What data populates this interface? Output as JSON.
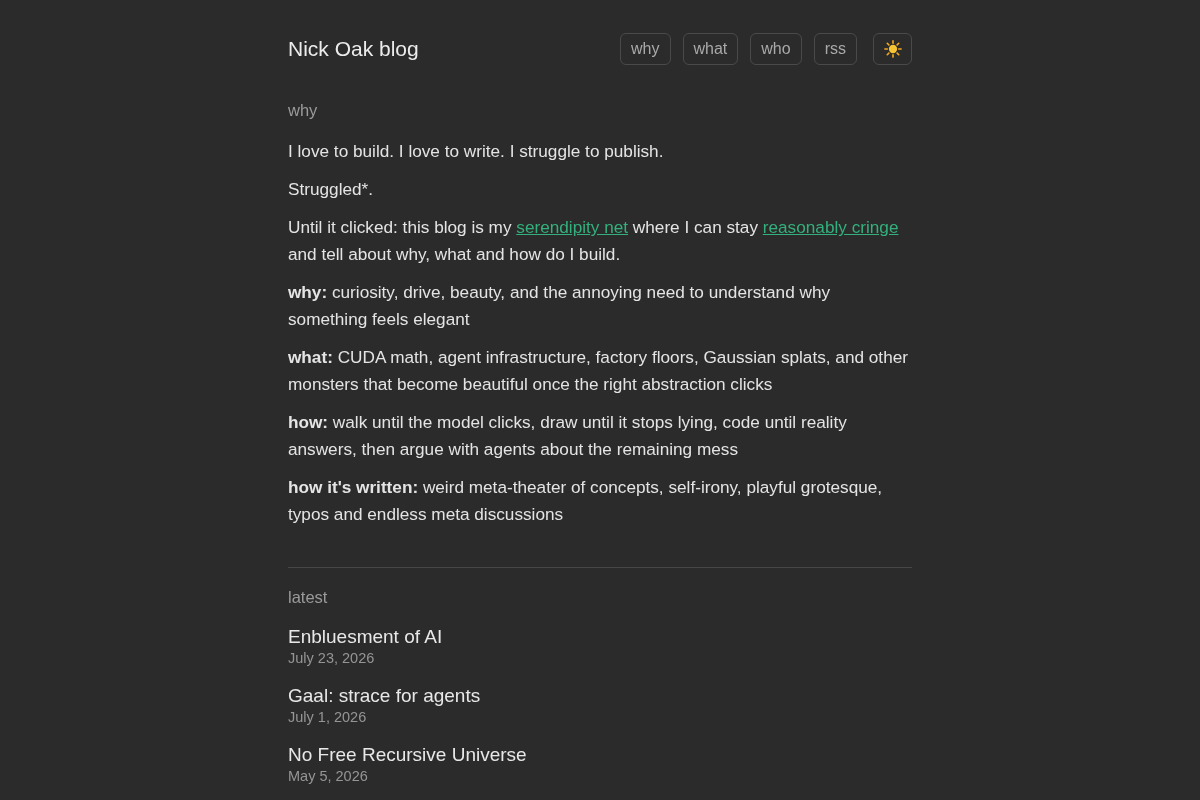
{
  "header": {
    "title": "Nick Oak blog",
    "nav": [
      "why",
      "what",
      "who",
      "rss"
    ]
  },
  "about": {
    "heading": "why",
    "paragraphs": [
      {
        "segments": [
          {
            "kind": "text",
            "text": "I love to build. I love to write. I struggle to publish."
          }
        ]
      },
      {
        "segments": [
          {
            "kind": "text",
            "text": "Struggled*."
          }
        ]
      },
      {
        "segments": [
          {
            "kind": "text",
            "text": "Until it clicked: this blog is my "
          },
          {
            "kind": "link",
            "text": "serendipity net"
          },
          {
            "kind": "text",
            "text": " where I can stay "
          },
          {
            "kind": "link",
            "text": "reasonably cringe"
          },
          {
            "kind": "text",
            "text": " and tell about why, what and how do I build."
          }
        ]
      },
      {
        "segments": [
          {
            "kind": "text",
            "text": "**why:** curiosity, drive, beauty, and the annoying need to understand why something feels elegant"
          }
        ]
      },
      {
        "segments": [
          {
            "kind": "text",
            "text": "**what:** CUDA math, agent infrastructure, factory floors, Gaussian splats, and other monsters that become beautiful once the right abstraction clicks"
          }
        ]
      },
      {
        "segments": [
          {
            "kind": "text",
            "text": "**how:** walk until the model clicks, draw until it stops lying, code until reality answers, then argue with agents about the remaining mess"
          }
        ]
      },
      {
        "segments": [
          {
            "kind": "text",
            "text": "**how it's written:** weird meta-theater of concepts, self-irony, playful grotesque, typos and endless meta discussions"
          }
        ]
      }
    ]
  },
  "latest": {
    "heading": "latest",
    "posts": [
      {
        "title": "Enbluesment of AI",
        "date": "July 23, 2026"
      },
      {
        "title": "Gaal: strace for agents",
        "date": "July 1, 2026"
      },
      {
        "title": "No Free Recursive Universe",
        "date": "May 5, 2026"
      }
    ]
  }
}
